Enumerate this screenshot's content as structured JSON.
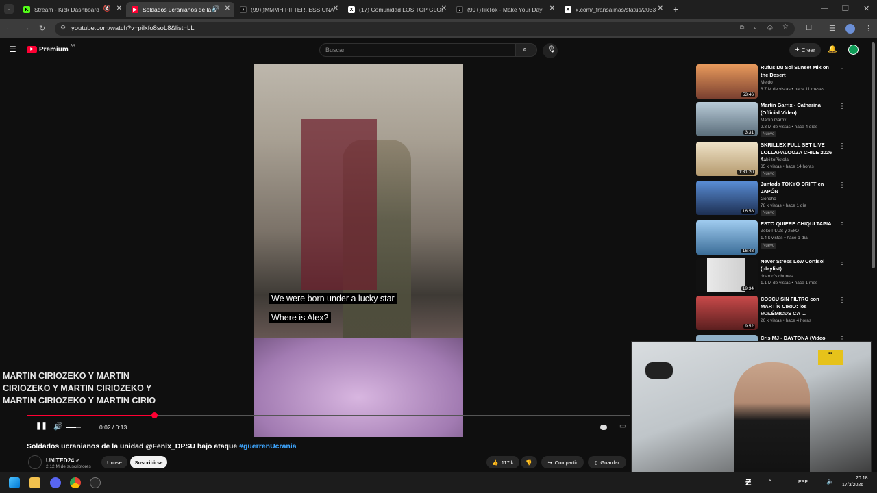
{
  "browser": {
    "tabs": [
      {
        "title": "Stream - Kick Dashboard",
        "favicon": "kick-icon"
      },
      {
        "title": "Soldados ucranianos de la u",
        "favicon": "youtube-icon",
        "active": true
      },
      {
        "title": "(99+)MMMH PIIITER, ESS UNA",
        "favicon": "tiktok-icon"
      },
      {
        "title": "(17) Comunidad LOS TOP GLOI",
        "favicon": "x-icon"
      },
      {
        "title": "(99+)TikTok - Make Your Day",
        "favicon": "tiktok-icon"
      },
      {
        "title": "x.com/_fransalinas/status/2033",
        "favicon": "x-icon"
      }
    ],
    "url": "youtube.com/watch?v=pilxfo8soL8&list=LL"
  },
  "youtube": {
    "logo": "Premium",
    "logo_sup": "AR",
    "search_placeholder": "Buscar",
    "create_label": "Crear"
  },
  "video": {
    "captions": [
      "We were born under a lucky star",
      "Where is Alex?"
    ],
    "overlay_text": "MARTIN CIRIOZEKO Y MARTIN CIRIOZEKO Y MARTIN CIRIOZEKO Y MARTIN CIRIOZEKO Y MARTIN CIRIO",
    "time": "0:02 / 0:13",
    "progress_fraction": 0.21,
    "volume_fraction": 0.7,
    "title": "Soldados ucranianos de la unidad @Fenix_DPSU bajo ataque",
    "hashtag": "#guerrenUcrania",
    "channel": "UNITED24",
    "subscribers": "2.12 M de suscriptores",
    "join_label": "Unirse",
    "subscribe_label": "Suscribirse",
    "likes": "117 k",
    "share_label": "Compartir",
    "save_label": "Guardar"
  },
  "recommendations": [
    {
      "title": "Rüfüs Du Sol Sunset Mix on the Desert",
      "channel": "Meldo",
      "meta": "8.7 M de vistas • hace 11 meses",
      "duration": "53:46",
      "badge": "",
      "color": "#c46a3e"
    },
    {
      "title": "Martin Garrix - Catharina (Official Video)",
      "channel": "Martin Garrix",
      "meta": "2.3 M de vistas • hace 4 días",
      "duration": "3:31",
      "badge": "Nuevo",
      "color": "#8aa4b8"
    },
    {
      "title": "SKRILLEX FULL SET LIVE LOLLAPALOOZA CHILE 2026 4...",
      "channel": "PabliitoPistola",
      "meta": "35 k vistas • hace 14 horas",
      "duration": "1:31:20",
      "badge": "Nuevo",
      "color": "#d9c8a8"
    },
    {
      "title": "Juntada TOKYO DRIFT en JAPÓN",
      "channel": "Goncho",
      "meta": "78 k vistas • hace 1 día",
      "duration": "16:58",
      "badge": "Nuevo",
      "color": "#3d6fb0"
    },
    {
      "title": "ESTO QUIERE CHIQUI TAPIA",
      "channel": "Zeko PLUS y zEkO",
      "meta": "1.4 k vistas • hace 1 día",
      "duration": "16:48",
      "badge": "Nuevo",
      "color": "#6aa6d6"
    },
    {
      "title": "Never Stress Low Cortisol (playlist)",
      "channel": "ricardo's chunes",
      "meta": "1.1 M de vistas • hace 1 mes",
      "duration": "19:34",
      "badge": "",
      "color": "#e6e6e6"
    },
    {
      "title": "COSCU SIN FILTRO con MARTÍN CIRIO: los POLÉMICOS CA ...",
      "channel": "MDA Noticias",
      "meta": "26 k vistas • hace 4 horas",
      "duration": "9:52",
      "badge": "",
      "color": "#b33a3a"
    },
    {
      "title": "Cris MJ - DAYTONA (Video",
      "channel": "",
      "meta": "",
      "duration": "",
      "badge": "",
      "color": "#8fb0c8"
    }
  ],
  "taskbar": {
    "lang": "ESP",
    "time": "20:18",
    "date": "17/3/2026"
  }
}
